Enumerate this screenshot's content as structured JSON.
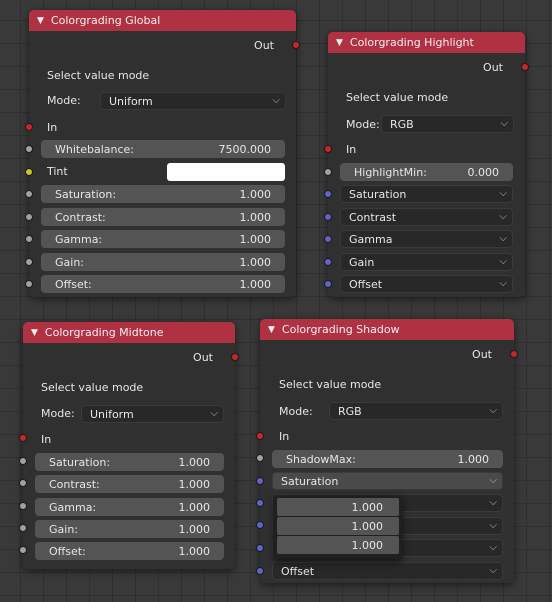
{
  "nodes": {
    "global": {
      "title": "Colorgrading Global",
      "out_label": "Out",
      "select_label": "Select value mode",
      "mode_label": "Mode:",
      "mode_value": "Uniform",
      "in_label": "In",
      "whitebalance": {
        "label": "Whitebalance:",
        "value": "7500.000"
      },
      "tint_label": "Tint",
      "tint_color": "#ffffff",
      "rows": [
        {
          "label": "Saturation:",
          "value": "1.000"
        },
        {
          "label": "Contrast:",
          "value": "1.000"
        },
        {
          "label": "Gamma:",
          "value": "1.000"
        },
        {
          "label": "Gain:",
          "value": "1.000"
        },
        {
          "label": "Offset:",
          "value": "1.000"
        }
      ]
    },
    "highlight": {
      "title": "Colorgrading Highlight",
      "out_label": "Out",
      "select_label": "Select value mode",
      "mode_label": "Mode:",
      "mode_value": "RGB",
      "in_label": "In",
      "highlightmin": {
        "label": "HighlightMin:",
        "value": "0.000"
      },
      "menus": [
        "Saturation",
        "Contrast",
        "Gamma",
        "Gain",
        "Offset"
      ]
    },
    "midtone": {
      "title": "Colorgrading Midtone",
      "out_label": "Out",
      "select_label": "Select value mode",
      "mode_label": "Mode:",
      "mode_value": "Uniform",
      "in_label": "In",
      "rows": [
        {
          "label": "Saturation:",
          "value": "1.000"
        },
        {
          "label": "Contrast:",
          "value": "1.000"
        },
        {
          "label": "Gamma:",
          "value": "1.000"
        },
        {
          "label": "Gain:",
          "value": "1.000"
        },
        {
          "label": "Offset:",
          "value": "1.000"
        }
      ]
    },
    "shadow": {
      "title": "Colorgrading Shadow",
      "out_label": "Out",
      "select_label": "Select value mode",
      "mode_label": "Mode:",
      "mode_value": "RGB",
      "in_label": "In",
      "shadowmax": {
        "label": "ShadowMax:",
        "value": "1.000"
      },
      "menus": [
        "Saturation",
        "",
        "",
        "",
        "Offset"
      ],
      "popup_values": [
        "1.000",
        "1.000",
        "1.000"
      ]
    }
  },
  "colors": {
    "header": "#b03142",
    "socket_color_output": "#c7272b",
    "socket_float": "#a1a1a1",
    "socket_color": "#c7c729",
    "socket_vector": "#6363c7"
  },
  "icons": {
    "collapse": "triangle-down-icon",
    "dropdown": "chevron-down-icon"
  }
}
